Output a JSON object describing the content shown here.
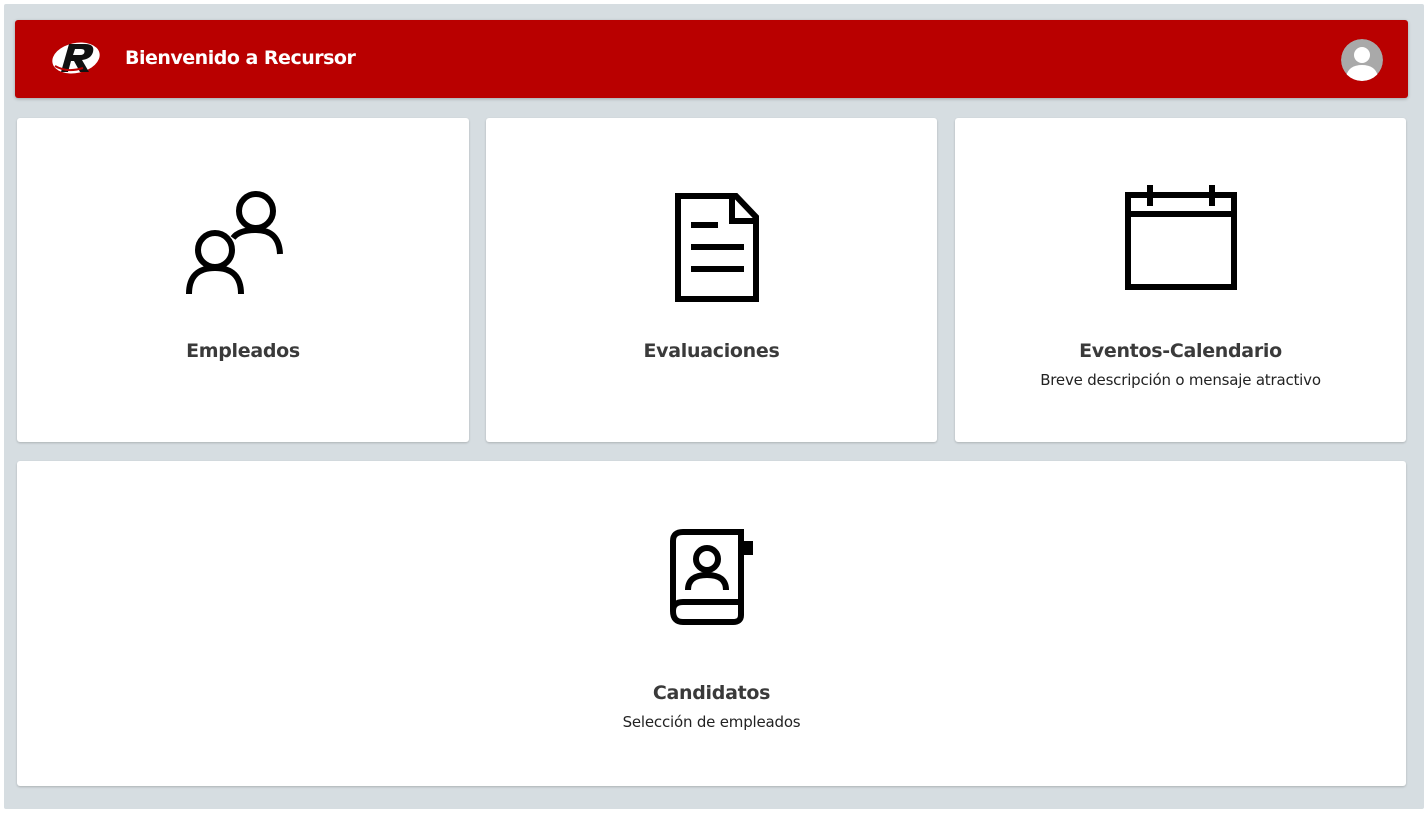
{
  "header": {
    "title": "Bienvenido a Recursor",
    "logo_icon": "recursor-r-logo",
    "avatar_icon": "user-avatar-icon",
    "background_color": "#b90000"
  },
  "cards": [
    {
      "label": "Empleados",
      "description": "",
      "icon": "users-icon"
    },
    {
      "label": "Evaluaciones",
      "description": "",
      "icon": "document-icon"
    },
    {
      "label": "Eventos-Calendario",
      "description": "Breve descripción o mensaje atractivo",
      "icon": "calendar-icon"
    },
    {
      "label": "Candidatos",
      "description": "Selección de empleados",
      "icon": "contact-book-icon"
    }
  ],
  "colors": {
    "page_background": "#d6dde1",
    "card_background": "#ffffff",
    "label_text": "#3a3a3a"
  }
}
